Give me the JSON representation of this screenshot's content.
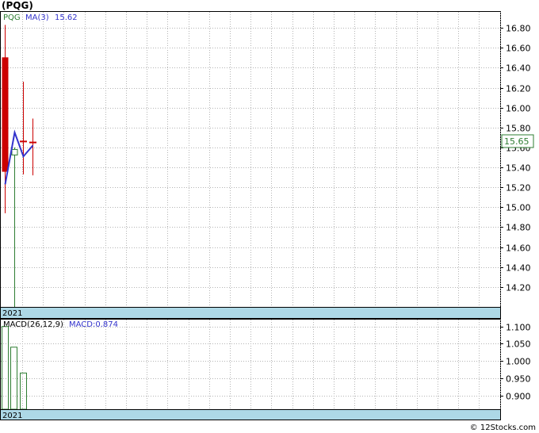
{
  "title": "(PQG)",
  "watermark": "© 12Stocks.com",
  "price_panel": {
    "symbol_label": "PQG",
    "ma_label": "MA(3)",
    "ma_value": "15.62",
    "last_price": "15.65",
    "year_label": "2021"
  },
  "macd_panel": {
    "label": "MACD(26,12,9)",
    "macd_value_label": "MACD:0.874",
    "year_label": "2021"
  },
  "colors": {
    "up": "#2e7d32",
    "down": "#cc0000",
    "ma_line": "#3333cc",
    "label_green": "#2e7d32",
    "label_blue": "#3333cc",
    "axis_band": "#add8e6",
    "grid": "#b4b4b4"
  },
  "chart_data": [
    {
      "type": "candlestick",
      "ylim": [
        14.0,
        16.96
      ],
      "yticks": [
        "14.20",
        "14.40",
        "14.60",
        "14.80",
        "15.00",
        "15.20",
        "15.40",
        "15.60",
        "15.80",
        "16.00",
        "16.20",
        "16.40",
        "16.60",
        "16.80"
      ],
      "candles": [
        {
          "open": 16.5,
          "high": 16.83,
          "low": 14.94,
          "close": 15.36,
          "color": "down"
        },
        {
          "open": 15.53,
          "high": 15.6,
          "low": 14.0,
          "close": 15.58,
          "color": "up"
        },
        {
          "open": 15.66,
          "high": 16.26,
          "low": 15.33,
          "close": 15.66,
          "color": "down"
        },
        {
          "open": 15.65,
          "high": 15.89,
          "low": 15.32,
          "close": 15.65,
          "color": "down"
        }
      ],
      "ma": [
        15.23,
        15.75,
        15.51,
        15.62
      ],
      "last_marker": 15.65
    },
    {
      "type": "bar",
      "ylim": [
        0.86,
        1.12
      ],
      "yticks": [
        "0.900",
        "0.950",
        "1.000",
        "1.050",
        "1.100"
      ],
      "values": [
        1.1,
        1.04,
        0.965
      ]
    }
  ]
}
